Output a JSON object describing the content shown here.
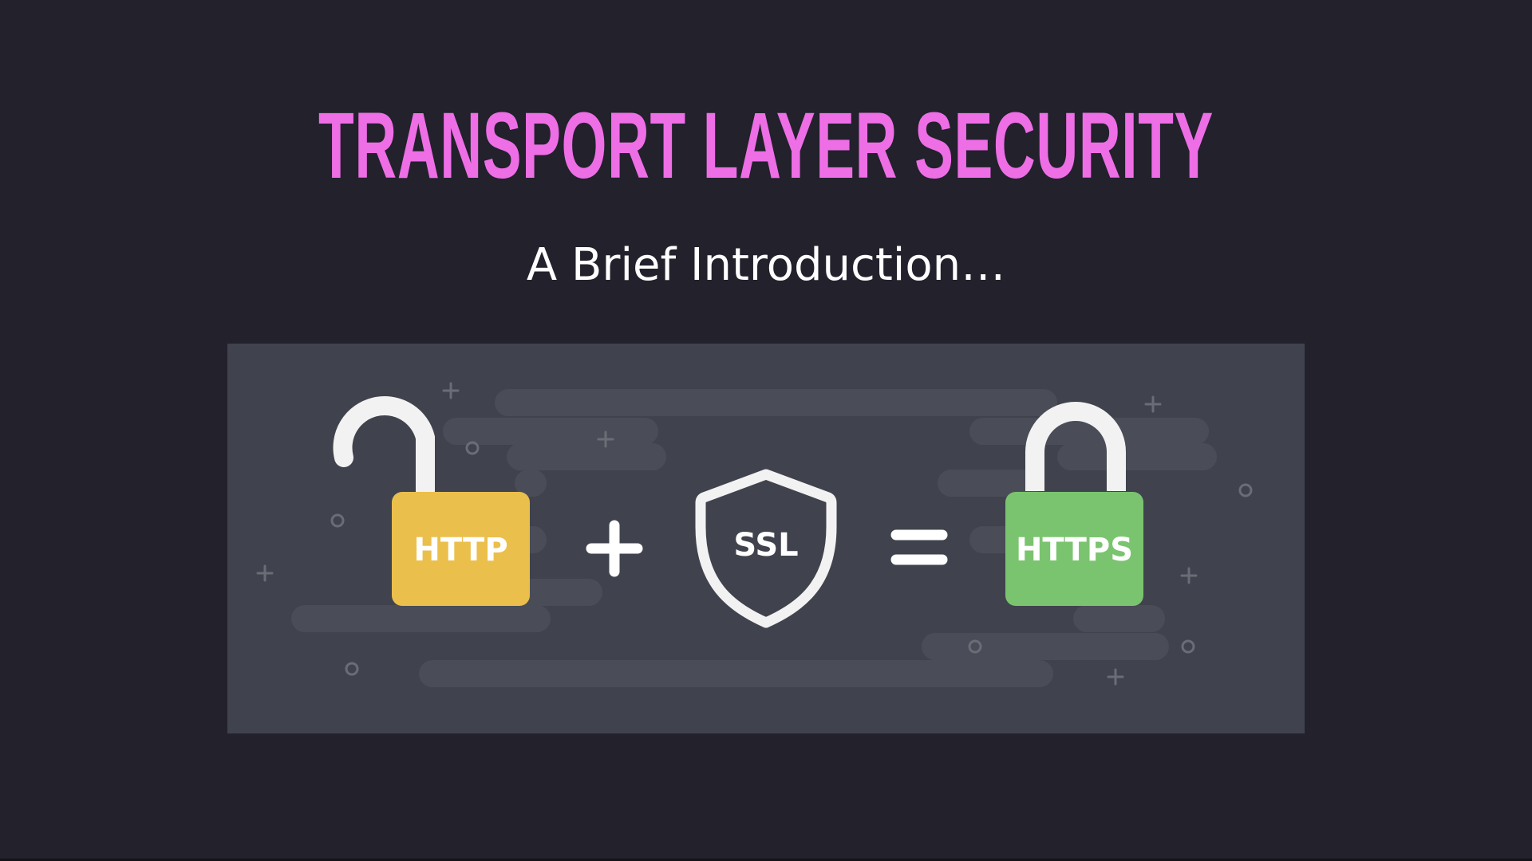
{
  "slide": {
    "title": "TRANSPORT LAYER SECURITY",
    "subtitle": "A Brief Introduction…"
  },
  "illustration": {
    "http_label": "HTTP",
    "ssl_label": "SSL",
    "https_label": "HTTPS",
    "colors": {
      "background": "#22212c",
      "title": "#ee6ee6",
      "panel": "#40434d",
      "http_lock": "#ebbf4b",
      "https_lock": "#7bc46f",
      "icon_light": "#f2f2f2"
    }
  }
}
